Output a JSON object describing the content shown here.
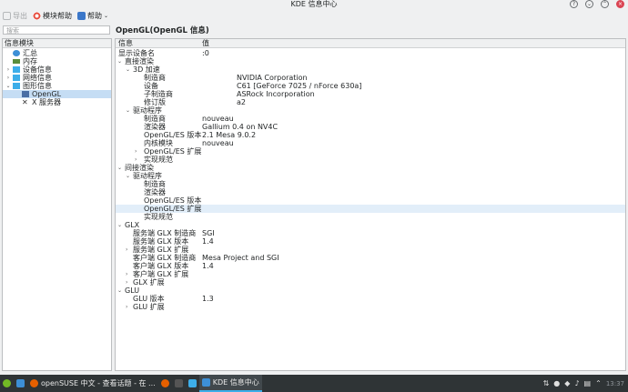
{
  "window": {
    "title": "KDE 信息中心"
  },
  "toolbar": {
    "export_label": "导出",
    "module_help_label": "模块帮助",
    "help_label": "帮助"
  },
  "search": {
    "placeholder": "搜索"
  },
  "page_title": "OpenGL(OpenGL 信息)",
  "left_panel": {
    "header": "信息模块",
    "items": [
      {
        "label": "汇总",
        "icon": "info-icon"
      },
      {
        "label": "内存",
        "icon": "memory-icon"
      },
      {
        "label": "设备信息",
        "icon": "folder-icon"
      },
      {
        "label": "网络信息",
        "icon": "folder-icon"
      },
      {
        "label": "图形信息",
        "icon": "folder-icon"
      },
      {
        "label": "OpenGL",
        "icon": "monitor-icon"
      },
      {
        "label": "X 服务器",
        "icon": "x-server-icon"
      }
    ]
  },
  "right_panel": {
    "col_info": "信息",
    "col_value": "值",
    "rows": [
      {
        "key": "显示设备名",
        "value": ":0"
      },
      {
        "key": "直接渲染",
        "value": ""
      },
      {
        "key": "3D 加速",
        "value": ""
      },
      {
        "key": "制造商",
        "value": "NVIDIA Corporation"
      },
      {
        "key": "设备",
        "value": "C61 [GeForce 7025 / nForce 630a]"
      },
      {
        "key": "子制造商",
        "value": "ASRock Incorporation"
      },
      {
        "key": "修订版",
        "value": "a2"
      },
      {
        "key": "驱动程序",
        "value": ""
      },
      {
        "key": "制造商",
        "value": "nouveau"
      },
      {
        "key": "渲染器",
        "value": "Gallium 0.4 on NV4C"
      },
      {
        "key": "OpenGL/ES 版本",
        "value": "2.1 Mesa 9.0.2"
      },
      {
        "key": "内核模块",
        "value": "nouveau"
      },
      {
        "key": "OpenGL/ES 扩展",
        "value": ""
      },
      {
        "key": "实现规范",
        "value": ""
      },
      {
        "key": "间接渲染",
        "value": ""
      },
      {
        "key": "驱动程序",
        "value": ""
      },
      {
        "key": "制造商",
        "value": ""
      },
      {
        "key": "渲染器",
        "value": ""
      },
      {
        "key": "OpenGL/ES 版本",
        "value": ""
      },
      {
        "key": "OpenGL/ES 扩展",
        "value": ""
      },
      {
        "key": "实现规范",
        "value": ""
      },
      {
        "key": "GLX",
        "value": ""
      },
      {
        "key": "服务端 GLX 制造商",
        "value": "SGI"
      },
      {
        "key": "服务端 GLX 版本",
        "value": "1.4"
      },
      {
        "key": "服务端 GLX 扩展",
        "value": ""
      },
      {
        "key": "客户端 GLX 制造商",
        "value": "Mesa Project and SGI"
      },
      {
        "key": "客户端 GLX 版本",
        "value": "1.4"
      },
      {
        "key": "客户端 GLX 扩展",
        "value": ""
      },
      {
        "key": "GLX 扩展",
        "value": ""
      },
      {
        "key": "GLU",
        "value": ""
      },
      {
        "key": "GLU 版本",
        "value": "1.3"
      },
      {
        "key": "GLU 扩展",
        "value": ""
      }
    ]
  },
  "taskbar": {
    "tasks": [
      {
        "label": "openSUSE 中文 - 查看话题 - 在 ..."
      },
      {
        "label": "KDE 信息中心"
      }
    ],
    "clock": "13:37"
  },
  "colors": {
    "accent": "#3daee9",
    "selection": "#c5ddf4",
    "taskbar": "#2f3436"
  }
}
